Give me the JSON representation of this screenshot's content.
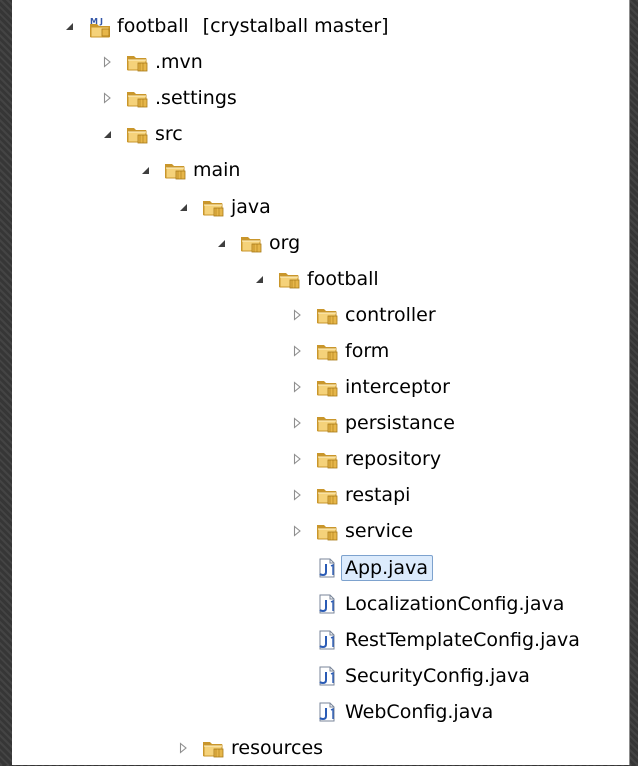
{
  "tree": [
    {
      "label": "football",
      "suffix": "[crystalball master]",
      "depth": 0,
      "toggle": "expanded",
      "icon": "maven-project-icon"
    },
    {
      "label": ".mvn",
      "depth": 1,
      "toggle": "collapsed",
      "icon": "folder-icon"
    },
    {
      "label": ".settings",
      "depth": 1,
      "toggle": "collapsed",
      "icon": "folder-icon"
    },
    {
      "label": "src",
      "depth": 1,
      "toggle": "expanded",
      "icon": "folder-icon"
    },
    {
      "label": "main",
      "depth": 2,
      "toggle": "expanded",
      "icon": "folder-icon"
    },
    {
      "label": "java",
      "depth": 3,
      "toggle": "expanded",
      "icon": "folder-icon"
    },
    {
      "label": "org",
      "depth": 4,
      "toggle": "expanded",
      "icon": "folder-icon"
    },
    {
      "label": "football",
      "depth": 5,
      "toggle": "expanded",
      "icon": "folder-icon"
    },
    {
      "label": "controller",
      "depth": 6,
      "toggle": "collapsed",
      "icon": "folder-icon"
    },
    {
      "label": "form",
      "depth": 6,
      "toggle": "collapsed",
      "icon": "folder-icon"
    },
    {
      "label": "interceptor",
      "depth": 6,
      "toggle": "collapsed",
      "icon": "folder-icon"
    },
    {
      "label": "persistance",
      "depth": 6,
      "toggle": "collapsed",
      "icon": "folder-icon"
    },
    {
      "label": "repository",
      "depth": 6,
      "toggle": "collapsed",
      "icon": "folder-icon"
    },
    {
      "label": "restapi",
      "depth": 6,
      "toggle": "collapsed",
      "icon": "folder-icon"
    },
    {
      "label": "service",
      "depth": 6,
      "toggle": "collapsed",
      "icon": "folder-icon"
    },
    {
      "label": "App.java",
      "depth": 6,
      "toggle": "none",
      "icon": "java-file-icon",
      "selected": true
    },
    {
      "label": "LocalizationConfig.java",
      "depth": 6,
      "toggle": "none",
      "icon": "java-file-icon"
    },
    {
      "label": "RestTemplateConfig.java",
      "depth": 6,
      "toggle": "none",
      "icon": "java-file-icon"
    },
    {
      "label": "SecurityConfig.java",
      "depth": 6,
      "toggle": "none",
      "icon": "java-file-icon"
    },
    {
      "label": "WebConfig.java",
      "depth": 6,
      "toggle": "none",
      "icon": "java-file-icon"
    },
    {
      "label": "resources",
      "depth": 3,
      "toggle": "collapsed",
      "icon": "folder-icon"
    }
  ],
  "colors": {
    "folder_fill": "#f5d27a",
    "folder_dark": "#c9962b",
    "java_blue": "#2a5bb5",
    "selection_bg": "#dcebfc",
    "selection_border": "#7da2ce"
  }
}
